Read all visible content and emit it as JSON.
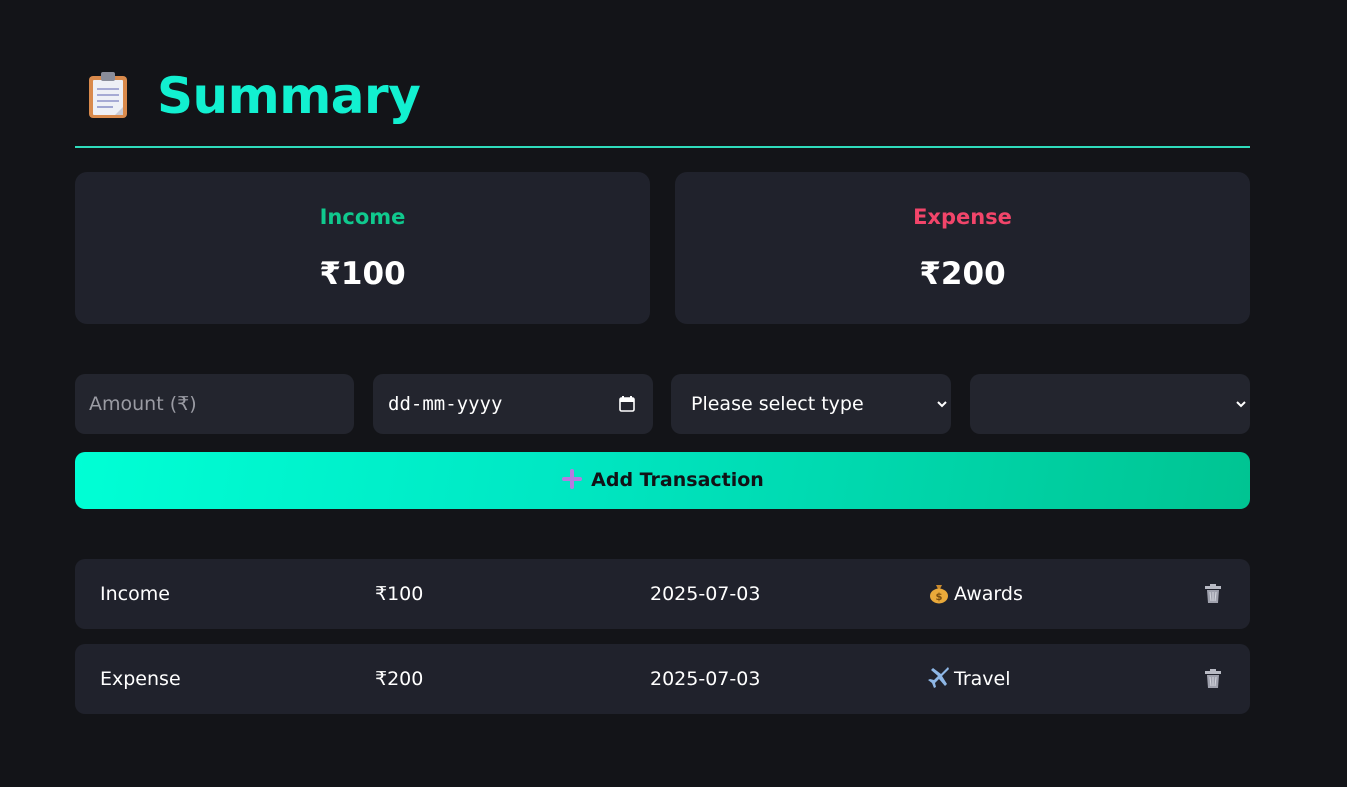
{
  "header": {
    "title": "Summary",
    "icon": "clipboard-icon"
  },
  "summary": {
    "income_label": "Income",
    "income_value": "₹100",
    "income_color": "#10c98e",
    "expense_label": "Expense",
    "expense_value": "₹200",
    "expense_color": "#f2456a"
  },
  "form": {
    "amount_placeholder": "Amount (₹)",
    "date_value": "dd-mm-yyyy",
    "type_value": "Please select type",
    "category_value": "",
    "add_button_label": "Add Transaction"
  },
  "transactions": [
    {
      "type": "Income",
      "amount": "₹100",
      "date": "2025-07-03",
      "category_icon": "money-bag-icon",
      "category": "Awards"
    },
    {
      "type": "Expense",
      "amount": "₹200",
      "date": "2025-07-03",
      "category_icon": "airplane-icon",
      "category": "Travel"
    }
  ],
  "colors": {
    "accent": "#12f0d0",
    "background": "#131418",
    "card": "#20222c"
  }
}
